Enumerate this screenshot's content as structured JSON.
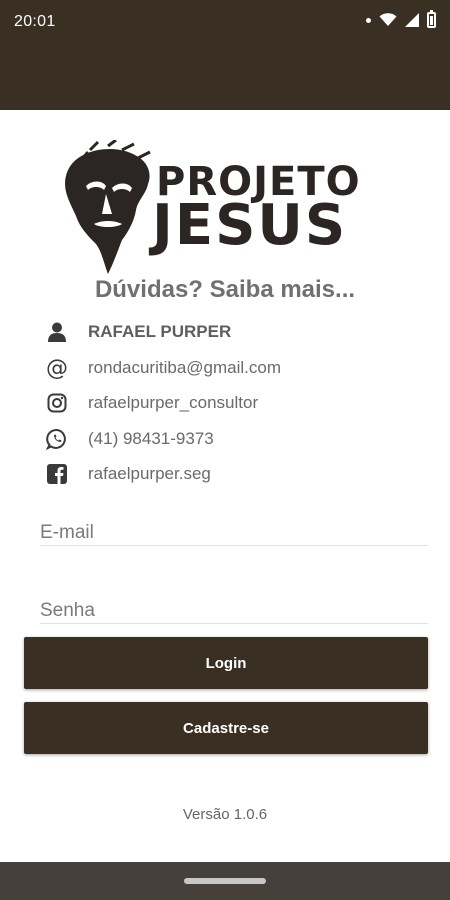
{
  "status_bar": {
    "time": "20:01"
  },
  "logo": {
    "line1": "PROJETO",
    "line2": "JESUS"
  },
  "heading": "Dúvidas? Saiba mais...",
  "contacts": [
    {
      "icon": "user-icon",
      "text": "RAFAEL PURPER"
    },
    {
      "icon": "at-sign-icon",
      "text": "rondacuritiba@gmail.com"
    },
    {
      "icon": "instagram-icon",
      "text": "rafaelpurper_consultor"
    },
    {
      "icon": "whatsapp-icon",
      "text": "(41) 98431-9373"
    },
    {
      "icon": "facebook-icon",
      "text": "rafaelpurper.seg"
    }
  ],
  "form": {
    "email_placeholder": "E-mail",
    "password_placeholder": "Senha",
    "login_label": "Login",
    "signup_label": "Cadastre-se"
  },
  "version": "Versão 1.0.6",
  "colors": {
    "primary": "#3a2f23",
    "text_gray": "#6a6a6a",
    "nav_bar": "#46403a"
  }
}
